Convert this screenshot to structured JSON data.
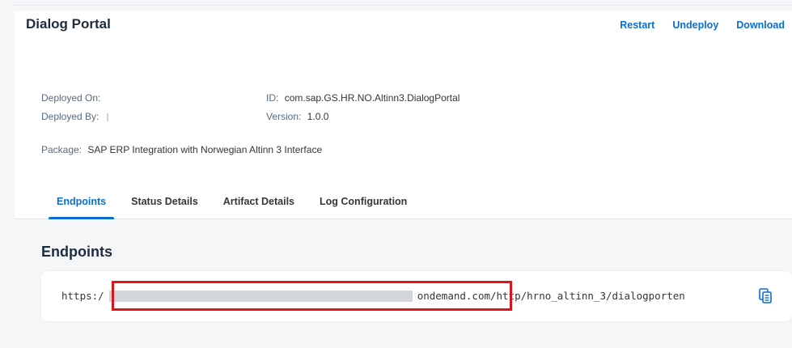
{
  "header": {
    "title": "Dialog Portal",
    "actions": [
      "Restart",
      "Undeploy",
      "Download"
    ]
  },
  "meta": {
    "deployed_on_label": "Deployed On:",
    "deployed_by_label": "Deployed By:",
    "id_label": "ID:",
    "id_value": "com.sap.GS.HR.NO.Altinn3.DialogPortal",
    "version_label": "Version:",
    "version_value": "1.0.0",
    "package_label": "Package:",
    "package_value": "SAP ERP Integration with Norwegian Altinn 3 Interface"
  },
  "tabs": [
    {
      "label": "Endpoints",
      "active": true
    },
    {
      "label": "Status Details",
      "active": false
    },
    {
      "label": "Artifact Details",
      "active": false
    },
    {
      "label": "Log Configuration",
      "active": false
    }
  ],
  "endpoints": {
    "section_title": "Endpoints",
    "url_prefix": "https:/",
    "url_suffix": "ondemand.com/http/hrno_altinn_3/dialogporten"
  },
  "icons": {
    "copy": "copy-icon"
  },
  "colors": {
    "accent": "#0a6ed1",
    "highlight": "#e0151a"
  }
}
